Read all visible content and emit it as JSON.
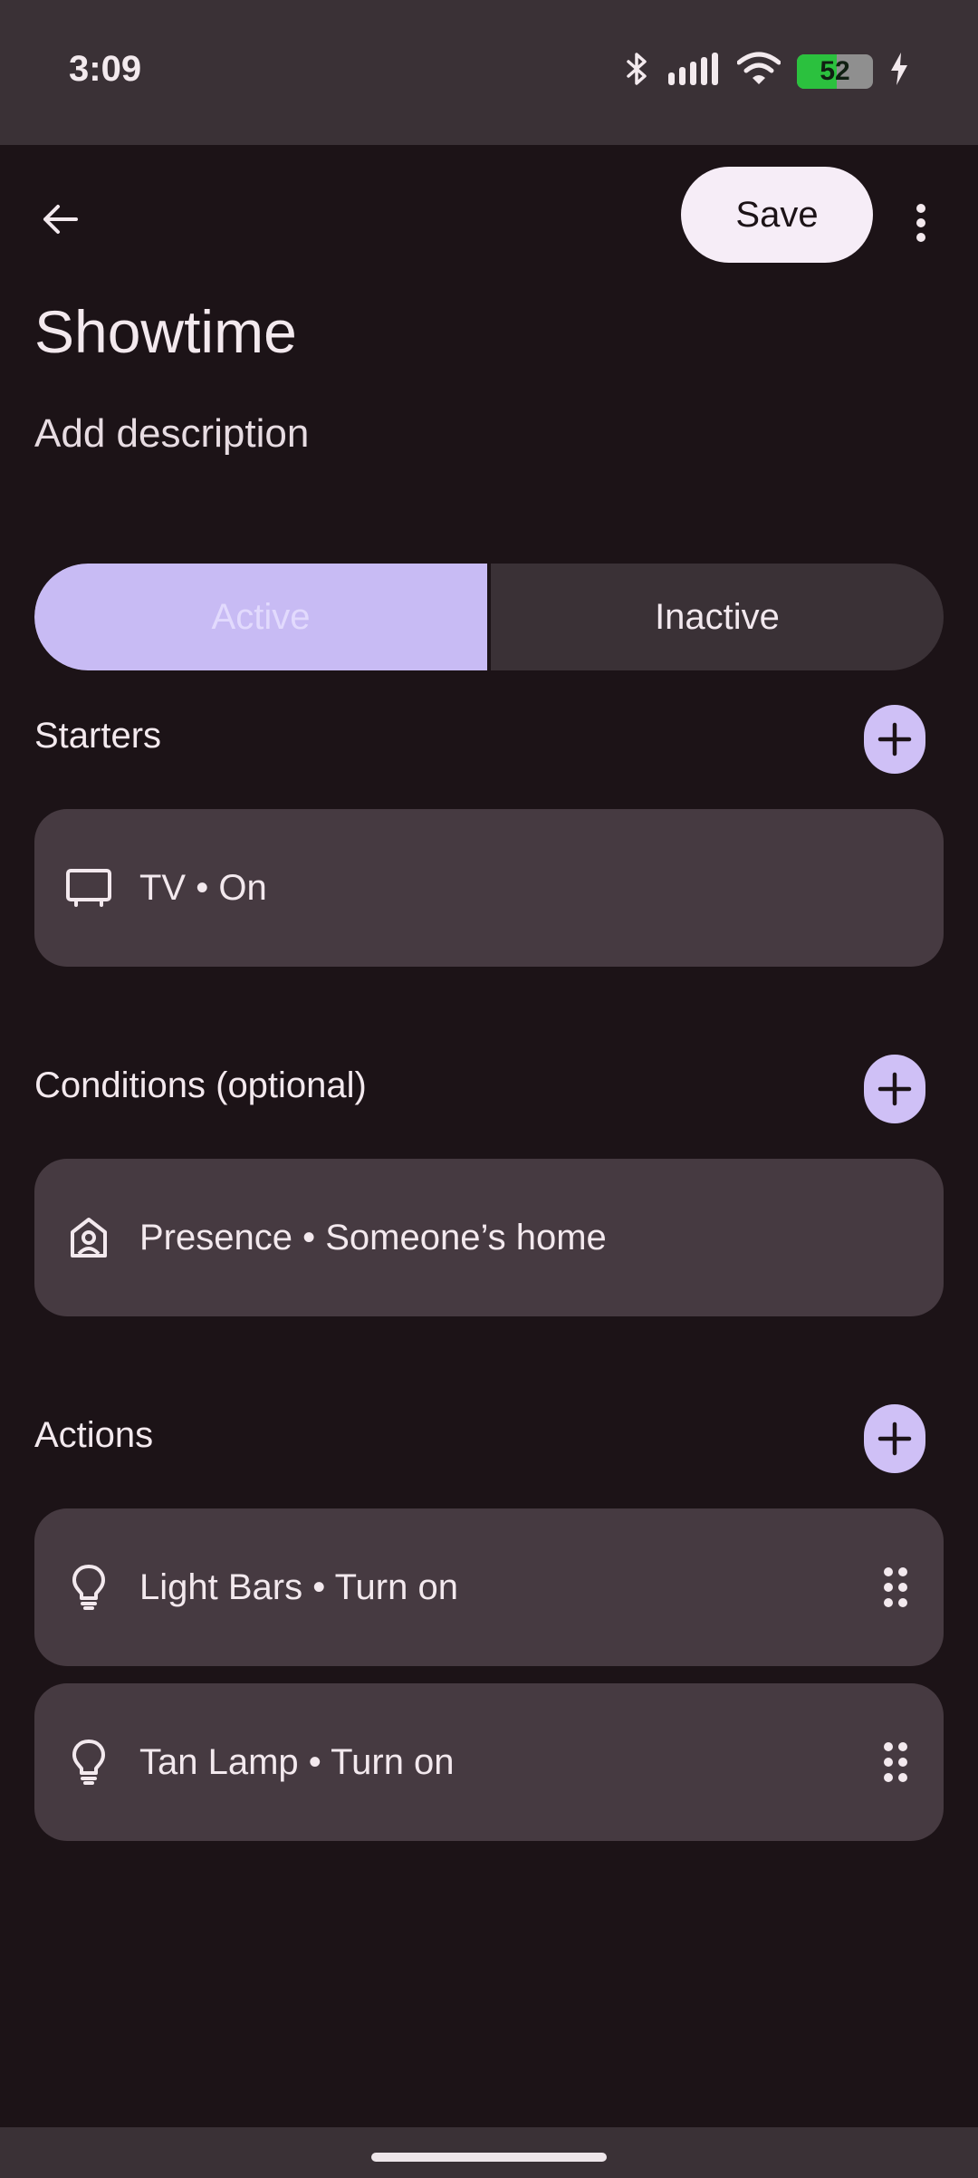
{
  "status_bar": {
    "time": "3:09",
    "battery_level": "52",
    "battery_fraction": 0.52,
    "icons": [
      "bluetooth-icon",
      "signal-icon",
      "wifi-icon",
      "battery-icon",
      "charging-icon"
    ]
  },
  "top_bar": {
    "save_label": "Save"
  },
  "routine": {
    "title": "Showtime",
    "description_placeholder": "Add description"
  },
  "status_toggle": {
    "active_label": "Active",
    "inactive_label": "Inactive",
    "selected": "Active"
  },
  "sections": {
    "starters": {
      "title": "Starters",
      "items": [
        {
          "label": "TV • On",
          "icon": "tv-icon"
        }
      ]
    },
    "conditions": {
      "title": "Conditions (optional)",
      "items": [
        {
          "label": "Presence • Someone’s home",
          "icon": "presence-icon"
        }
      ]
    },
    "actions": {
      "title": "Actions",
      "items": [
        {
          "label": "Light Bars • Turn on",
          "icon": "lightbulb-icon"
        },
        {
          "label": "Tan Lamp • Turn on",
          "icon": "lightbulb-icon"
        }
      ]
    }
  },
  "colors": {
    "background": "#1c1317",
    "card": "#463a41",
    "accent": "#cfc0f6",
    "save_button": "#f6edf7"
  }
}
